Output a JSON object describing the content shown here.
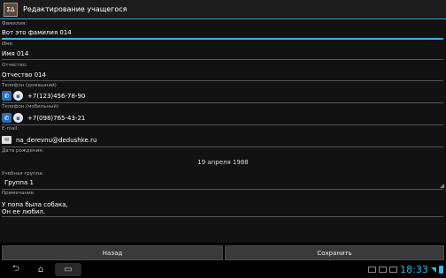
{
  "actionbar": {
    "title": "Редактирование учащегося",
    "app_icon_text": "ΣΔ"
  },
  "form": {
    "surname": {
      "label": "Фамилия:",
      "value": "Вот это фамилия 014"
    },
    "name": {
      "label": "Имя:",
      "value": "Имя 014"
    },
    "patronymic": {
      "label": "Отчество:",
      "value": "Отчество 014"
    },
    "phone_home": {
      "label": "Телефон (домашний)",
      "value": "+7(123)456-78-90"
    },
    "phone_mobile": {
      "label": "Телефон (мобильный)",
      "value": "+7(098)765-43-21"
    },
    "email": {
      "label": "E-mail:",
      "value": "na_derevnu@dedushke.ru"
    },
    "birthdate": {
      "label": "Дата рождения:",
      "value": "19 апреля 1988"
    },
    "group": {
      "label": "Учебная группа:",
      "value": "Группа 1"
    },
    "note": {
      "label": "Примечание:",
      "line1": "У попа была собака,",
      "line2": "Он ее любил."
    }
  },
  "buttons": {
    "back": "Назад",
    "save": "Сохранить"
  },
  "statusbar": {
    "time": "18:33"
  },
  "colors": {
    "accent": "#33b5e5",
    "background": "#121212"
  }
}
